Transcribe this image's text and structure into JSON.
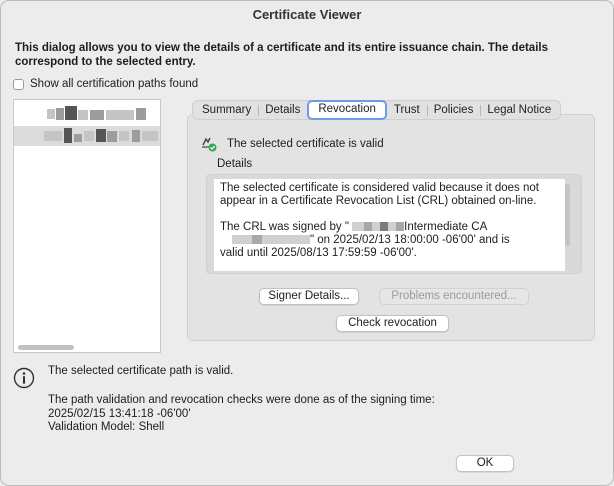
{
  "window": {
    "title": "Certificate Viewer"
  },
  "intro_text": "This dialog allows you to view the details of a certificate and its entire issuance chain. The details correspond to the selected entry.",
  "show_all_paths": {
    "label": "Show all certification paths found",
    "checked": false
  },
  "tabs": [
    {
      "label": "Summary",
      "active": false
    },
    {
      "label": "Details",
      "active": false
    },
    {
      "label": "Revocation",
      "active": true
    },
    {
      "label": "Trust",
      "active": false
    },
    {
      "label": "Policies",
      "active": false
    },
    {
      "label": "Legal Notice",
      "active": false
    }
  ],
  "revocation": {
    "status_text": "The selected certificate is valid",
    "details_label": "Details",
    "details_para1": "The selected certificate is considered valid because it does not appear in a Certificate Revocation List (CRL) obtained on-line.",
    "crl_signed_prefix": "The CRL was signed by \"",
    "crl_issuer_suffix": "Intermediate CA",
    "crl_date_text": "\" on 2025/02/13 18:00:00 -06'00' and is",
    "crl_valid_until": "valid until 2025/08/13 17:59:59 -06'00'.",
    "signer_details_button": "Signer Details...",
    "problems_button": "Problems encountered...",
    "check_revocation_button": "Check revocation"
  },
  "path_status": "The selected certificate path is valid.",
  "path_info": {
    "line1": "The path validation and revocation checks were done as of the signing time:",
    "line2": "2025/02/15 13:41:18 -06'00'",
    "line3": "Validation Model: Shell"
  },
  "ok_button": "OK",
  "colors": {
    "accent_focus": "#6e9be3",
    "valid_green": "#2fa84f"
  }
}
